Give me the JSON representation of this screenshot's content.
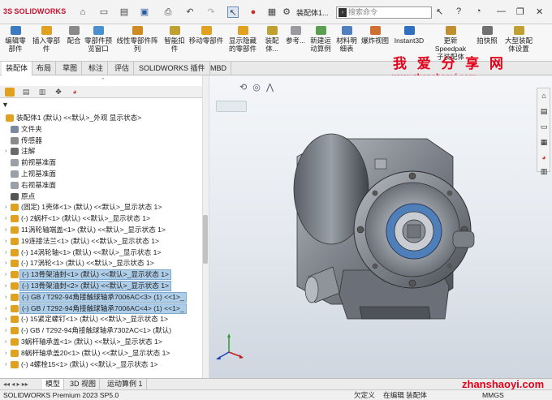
{
  "app": {
    "brand_prefix": "3S",
    "brand": "SOLIDWORKS",
    "doc_title": "装配体1...",
    "search_placeholder": "搜索命令"
  },
  "ribbon": [
    {
      "label": "编辑零\n部件",
      "icon": "edit-part-icon",
      "color": "#3c7bc0"
    },
    {
      "label": "插入零部件",
      "icon": "insert-component-icon",
      "color": "#e0a020"
    },
    {
      "label": "配合",
      "icon": "mate-icon",
      "color": "#8a8a8a"
    },
    {
      "label": "零部件预\n览窗口",
      "icon": "preview-window-icon",
      "color": "#4a90d0"
    },
    {
      "label": "线性零部件阵列",
      "icon": "linear-pattern-icon",
      "color": "#d08a20"
    },
    {
      "label": "智能扣\n件",
      "icon": "smart-fastener-icon",
      "color": "#c0a030"
    },
    {
      "label": "移动零部件",
      "icon": "move-component-icon",
      "color": "#e0a020"
    },
    {
      "label": "显示隐藏\n的零部件",
      "icon": "show-hidden-icon",
      "color": "#e0a020"
    },
    {
      "label": "装配体...",
      "icon": "assembly-features-icon",
      "color": "#c0a030"
    },
    {
      "label": "参考...",
      "icon": "reference-geometry-icon",
      "color": "#9a9aa0"
    },
    {
      "label": "新建运\n动算例",
      "icon": "new-motion-study-icon",
      "color": "#5aa050"
    },
    {
      "label": "材料明\n细表",
      "icon": "bom-icon",
      "color": "#5080c0"
    },
    {
      "label": "爆炸视图",
      "icon": "exploded-view-icon",
      "color": "#d07030"
    },
    {
      "label": "Instant3D",
      "icon": "instant3d-icon",
      "color": "#3070c0"
    },
    {
      "label": "更新 Speedpak\n子装配体",
      "icon": "speedpak-icon",
      "color": "#c09030"
    },
    {
      "label": "拍快照",
      "icon": "snapshot-icon",
      "color": "#707070"
    },
    {
      "label": "大型装配\n体设置",
      "icon": "large-assembly-icon",
      "color": "#c0a030"
    }
  ],
  "tabs": [
    {
      "label": "装配体",
      "active": true
    },
    {
      "label": "布局",
      "active": false
    },
    {
      "label": "草图",
      "active": false
    },
    {
      "label": "标注",
      "active": false
    },
    {
      "label": "评估",
      "active": false
    },
    {
      "label": "SOLIDWORKS 插件",
      "active": false
    },
    {
      "label": "MBD",
      "active": false
    }
  ],
  "watermark": {
    "line1": "我 爱 分 享 网",
    "line2": "www.zhanshaoyi.com",
    "bottom": "zhanshaoyi.com"
  },
  "tree": [
    {
      "text": "装配体1 (默认) <<默认>_外观 显示状态>",
      "indent": 0,
      "arrow": "",
      "icon": "assembly-icon",
      "color": "#e0a020",
      "sel": false
    },
    {
      "text": "文件夹",
      "indent": 1,
      "arrow": "",
      "icon": "folder-icon",
      "color": "#7a8aa0",
      "sel": false
    },
    {
      "text": "传感器",
      "indent": 1,
      "arrow": "",
      "icon": "sensor-icon",
      "color": "#8a8a8a",
      "sel": false
    },
    {
      "text": "注解",
      "indent": 1,
      "arrow": "›",
      "icon": "annotation-icon",
      "color": "#6a6a6a",
      "sel": false
    },
    {
      "text": "前视基准面",
      "indent": 1,
      "arrow": "",
      "icon": "plane-icon",
      "color": "#9aa0a8",
      "sel": false
    },
    {
      "text": "上视基准面",
      "indent": 1,
      "arrow": "",
      "icon": "plane-icon",
      "color": "#9aa0a8",
      "sel": false
    },
    {
      "text": "右视基准面",
      "indent": 1,
      "arrow": "",
      "icon": "plane-icon",
      "color": "#9aa0a8",
      "sel": false
    },
    {
      "text": "原点",
      "indent": 1,
      "arrow": "",
      "icon": "origin-icon",
      "color": "#555555",
      "sel": false
    },
    {
      "text": "(固定) 1壳体<1> (默认) <<默认>_显示状态 1>",
      "indent": 1,
      "arrow": "›",
      "icon": "part-icon",
      "color": "#e0a020",
      "sel": false
    },
    {
      "text": "(-) 2蜗杆<1> (默认) <<默认>_显示状态 1>",
      "indent": 1,
      "arrow": "›",
      "icon": "part-icon",
      "color": "#e0a020",
      "sel": false
    },
    {
      "text": "11涡轮轴端盖<1> (默认) <<默认>_显示状态 1>",
      "indent": 1,
      "arrow": "›",
      "icon": "part-icon",
      "color": "#e0a020",
      "sel": false
    },
    {
      "text": "19连接法兰<1> (默认) <<默认>_显示状态 1>",
      "indent": 1,
      "arrow": "›",
      "icon": "part-icon",
      "color": "#e0a020",
      "sel": false
    },
    {
      "text": "(-) 14涡轮轴<1> (默认) <<默认>_显示状态 1>",
      "indent": 1,
      "arrow": "›",
      "icon": "part-icon",
      "color": "#e0a020",
      "sel": false
    },
    {
      "text": "(-) 17涡轮<1> (默认) <<默认>_显示状态 1>",
      "indent": 1,
      "arrow": "›",
      "icon": "part-icon",
      "color": "#e0a020",
      "sel": false
    },
    {
      "text": "(-) 13骨架油封<1> (默认) <<默认>_显示状态 1>",
      "indent": 1,
      "arrow": "›",
      "icon": "part-icon",
      "color": "#e0a020",
      "sel": true
    },
    {
      "text": "(-) 13骨架油封<2> (默认) <<默认>_显示状态 1>",
      "indent": 1,
      "arrow": "›",
      "icon": "part-icon",
      "color": "#e0a020",
      "sel": true
    },
    {
      "text": "(-) GB / T292-94角接触球轴承7006AC<3> (1) <<1>_",
      "indent": 1,
      "arrow": "›",
      "icon": "part-icon",
      "color": "#e0a020",
      "sel": true
    },
    {
      "text": "(-) GB / T292-94角接触球轴承7006AC<4> (1) <<1>_",
      "indent": 1,
      "arrow": "›",
      "icon": "part-icon",
      "color": "#e0a020",
      "sel": true
    },
    {
      "text": "(-) 15紧定螺钉<1> (默认) <<默认>_显示状态 1>",
      "indent": 1,
      "arrow": "›",
      "icon": "part-icon",
      "color": "#e0a020",
      "sel": false
    },
    {
      "text": "(-) GB / T292-94角接触球轴承7302AC<1> (默认)",
      "indent": 1,
      "arrow": "›",
      "icon": "part-icon",
      "color": "#e0a020",
      "sel": false
    },
    {
      "text": "3蜗杆轴承盖<1> (默认) <<默认>_显示状态 1>",
      "indent": 1,
      "arrow": "›",
      "icon": "part-icon",
      "color": "#e0a020",
      "sel": false
    },
    {
      "text": "8蜗杆轴承盖20<1> (默认) <<默认>_显示状态 1>",
      "indent": 1,
      "arrow": "›",
      "icon": "part-icon",
      "color": "#e0a020",
      "sel": false
    },
    {
      "text": "(-) 4螺栓15<1> (默认) <<默认>_显示状态 1>",
      "indent": 1,
      "arrow": "›",
      "icon": "part-icon",
      "color": "#e0a020",
      "sel": false
    }
  ],
  "bottom_tabs": [
    {
      "label": "模型",
      "active": true
    },
    {
      "label": "3D 视图",
      "active": false
    },
    {
      "label": "运动算例 1",
      "active": false
    }
  ],
  "status": {
    "product": "SOLIDWORKS Premium 2023 SP5.0",
    "state1": "欠定义",
    "state2": "在编辑 装配体",
    "units": "MMGS"
  }
}
